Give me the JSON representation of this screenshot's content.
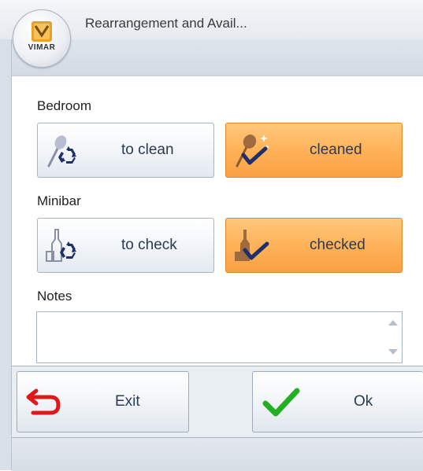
{
  "window": {
    "title": "Rearrangement and Avail...",
    "logo_text": "VIMAR"
  },
  "bedroom": {
    "label": "Bedroom",
    "to_clean_label": "to clean",
    "cleaned_label": "cleaned",
    "selected": "cleaned"
  },
  "minibar": {
    "label": "Minibar",
    "to_check_label": "to check",
    "checked_label": "checked",
    "selected": "checked"
  },
  "notes": {
    "label": "Notes",
    "value": ""
  },
  "actions": {
    "exit_label": "Exit",
    "ok_label": "Ok"
  },
  "colors": {
    "selected_orange": "#ffb259",
    "button_text": "#2a3a55",
    "exit_arrow_red": "#e01818",
    "ok_check_green": "#22b022",
    "recycle_navy": "#1f2f6a"
  },
  "icons": [
    "vimar-logo-icon",
    "broom-recycle-icon",
    "broom-check-icon",
    "bottle-recycle-icon",
    "bottle-check-icon",
    "exit-arrow-icon",
    "ok-check-icon"
  ]
}
